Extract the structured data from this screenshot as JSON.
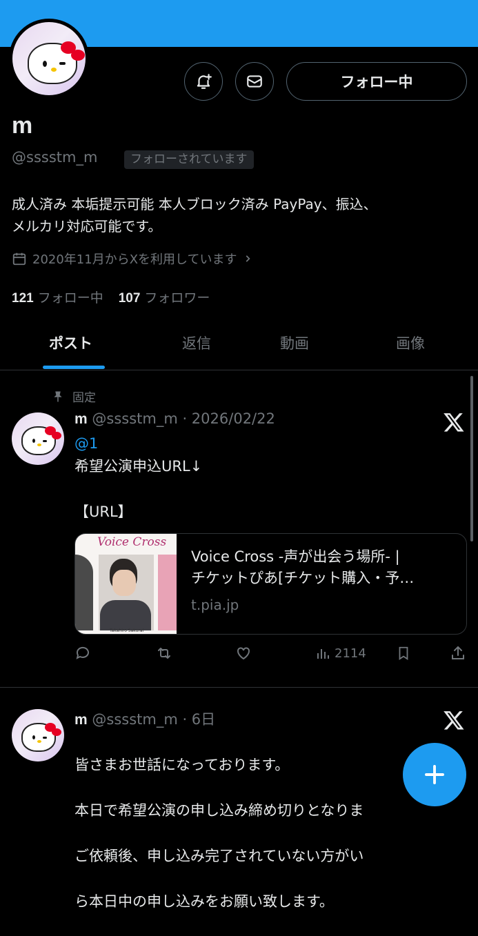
{
  "profile": {
    "name": "m",
    "handle": "@sssstm_m",
    "follows_you": "フォローされています",
    "follow_button": "フォロー中",
    "bio_line1": "成人済み 本垢提示可能 本人ブロック済み PayPay、振込、",
    "bio_line2": "メルカリ対応可能です。",
    "joined": "2020年11月からXを利用しています",
    "following_count": "121",
    "following_label": "フォロー中",
    "followers_count": "107",
    "followers_label": "フォロワー"
  },
  "tabs": [
    "ポスト",
    "返信",
    "動画",
    "画像"
  ],
  "posts": [
    {
      "pinned_label": "固定",
      "name": "m",
      "handle_time": "@sssstm_m · 2026/02/22",
      "mention": "@1",
      "text": "希望公演申込URL↓\n\n【URL】",
      "card": {
        "title_line1": "Voice Cross -声が出会う場所- |",
        "title_line2": "チケットぴあ[チケット購入・予…",
        "domain": "t.pia.jp",
        "image_brand": "Voice Cross",
        "image_caption": "Takahiro Sakurai"
      },
      "views": "2114"
    },
    {
      "name": "m",
      "handle_time": "@sssstm_m · 6日",
      "line1": "皆さまお世話になっております。",
      "line2": "本日で希望公演の申し込み締め切りとなりま",
      "line3": "ご依頼後、申し込み完了されていない方がい",
      "line4": "ら本日中の申し込みをお願い致します。"
    }
  ],
  "icons": {
    "notify": "bell-plus-icon",
    "message": "envelope-icon",
    "calendar": "calendar-icon",
    "pin": "pin-icon",
    "x": "x-logo-icon",
    "reply": "reply-icon",
    "repost": "repost-icon",
    "like": "heart-icon",
    "views": "views-icon",
    "bookmark": "bookmark-icon",
    "share": "share-icon",
    "compose": "plus-icon"
  },
  "colors": {
    "accent": "#1d9bf0",
    "background": "#000000",
    "text": "#e7e9ea",
    "muted": "#71767b"
  }
}
